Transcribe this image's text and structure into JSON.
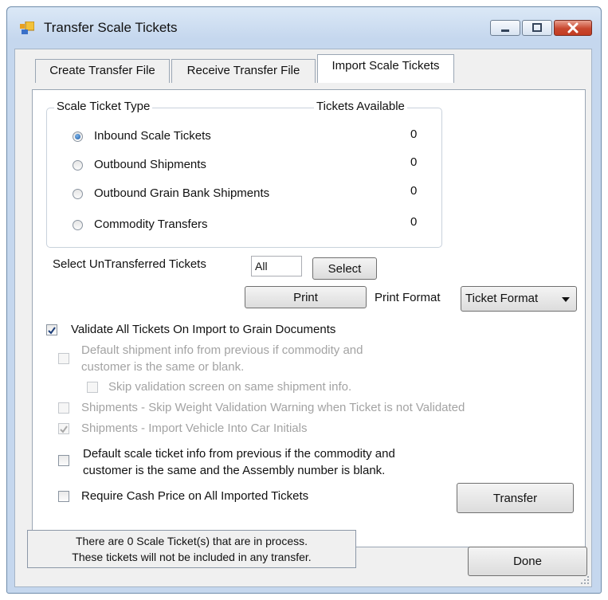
{
  "window": {
    "title": "Transfer Scale Tickets"
  },
  "tabs": [
    {
      "label": "Create Transfer File"
    },
    {
      "label": "Receive Transfer File"
    },
    {
      "label": "Import Scale Tickets"
    }
  ],
  "ticket_type_group": {
    "title": "Scale Ticket Type",
    "available_header": "Tickets Available",
    "options": [
      {
        "label": "Inbound Scale Tickets",
        "count": "0",
        "selected": true
      },
      {
        "label": "Outbound Shipments",
        "count": "0",
        "selected": false
      },
      {
        "label": "Outbound Grain Bank Shipments",
        "count": "0",
        "selected": false
      },
      {
        "label": "Commodity Transfers",
        "count": "0",
        "selected": false
      }
    ]
  },
  "select_untransferred": {
    "label": "Select UnTransferred Tickets",
    "value": "All",
    "button": "Select"
  },
  "print": {
    "button": "Print",
    "format_label": "Print Format",
    "format_value": "Ticket Format"
  },
  "options": {
    "validate_all": "Validate All Tickets On Import to Grain Documents",
    "default_shipment_line1": "Default shipment info from previous if commodity and",
    "default_shipment_line2": "customer is the same or blank.",
    "skip_validation": "Skip validation screen on same shipment info.",
    "skip_weight": "Shipments - Skip Weight Validation Warning when Ticket is not Validated",
    "import_vehicle": "Shipments - Import Vehicle Into Car Initials",
    "default_scale_line1": "Default scale ticket info from previous if the commodity and",
    "default_scale_line2": "customer is the same and the Assembly number is blank.",
    "require_cash": "Require Cash Price on All Imported Tickets"
  },
  "buttons": {
    "transfer": "Transfer",
    "done": "Done"
  },
  "status": {
    "line1": "There are 0 Scale Ticket(s) that are in process.",
    "line2": "These tickets will not be included in any transfer."
  }
}
